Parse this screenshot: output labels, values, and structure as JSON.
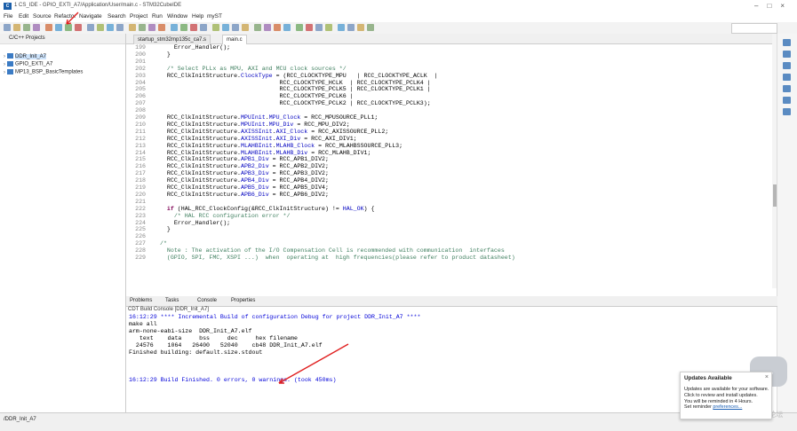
{
  "window": {
    "title": "1 CS_IDE - GPIO_EXTI_A7/Application/User/main.c - STM32CubeIDE"
  },
  "menu": [
    "File",
    "Edit",
    "Source",
    "Refactor",
    "Navigate",
    "Search",
    "Project",
    "Run",
    "Window",
    "Help",
    "myST"
  ],
  "project_explorer": {
    "title": "C/C++ Projects",
    "projects": [
      {
        "name": "DDR_Init_A7",
        "selected": true
      },
      {
        "name": "GPIO_EXTI_A7",
        "selected": false
      },
      {
        "name": "MP13_BSP_BasicTemplates",
        "selected": false
      }
    ]
  },
  "editor": {
    "tabs": [
      {
        "label": "startup_stm32mp135c_ca7.s",
        "active": false
      },
      {
        "label": "main.c",
        "active": true
      }
    ],
    "lines": [
      {
        "n": "199",
        "t": "    Error_Handler();"
      },
      {
        "n": "200",
        "t": "  }"
      },
      {
        "n": "201",
        "t": ""
      },
      {
        "n": "202",
        "t": "  /* Select PLLx as MPU, AXI and MCU clock sources */"
      },
      {
        "n": "203",
        "t": "  RCC_ClkInitStructure.ClockType = (RCC_CLOCKTYPE_MPU   | RCC_CLOCKTYPE_ACLK  |"
      },
      {
        "n": "204",
        "t": "                                  RCC_CLOCKTYPE_HCLK  | RCC_CLOCKTYPE_PCLK4 |"
      },
      {
        "n": "205",
        "t": "                                  RCC_CLOCKTYPE_PCLK5 | RCC_CLOCKTYPE_PCLK1 |"
      },
      {
        "n": "206",
        "t": "                                  RCC_CLOCKTYPE_PCLK6 |"
      },
      {
        "n": "207",
        "t": "                                  RCC_CLOCKTYPE_PCLK2 | RCC_CLOCKTYPE_PCLK3);"
      },
      {
        "n": "208",
        "t": ""
      },
      {
        "n": "209",
        "t": "  RCC_ClkInitStructure.MPUInit.MPU_Clock = RCC_MPUSOURCE_PLL1;"
      },
      {
        "n": "210",
        "t": "  RCC_ClkInitStructure.MPUInit.MPU_Div = RCC_MPU_DIV2;"
      },
      {
        "n": "211",
        "t": "  RCC_ClkInitStructure.AXISSInit.AXI_Clock = RCC_AXISSOURCE_PLL2;"
      },
      {
        "n": "212",
        "t": "  RCC_ClkInitStructure.AXISSInit.AXI_Div = RCC_AXI_DIV1;"
      },
      {
        "n": "213",
        "t": "  RCC_ClkInitStructure.MLAHBInit.MLAHB_Clock = RCC_MLAHBSSOURCE_PLL3;"
      },
      {
        "n": "214",
        "t": "  RCC_ClkInitStructure.MLAHBInit.MLAHB_Div = RCC_MLAHB_DIV1;"
      },
      {
        "n": "215",
        "t": "  RCC_ClkInitStructure.APB1_Div = RCC_APB1_DIV2;"
      },
      {
        "n": "216",
        "t": "  RCC_ClkInitStructure.APB2_Div = RCC_APB2_DIV2;"
      },
      {
        "n": "217",
        "t": "  RCC_ClkInitStructure.APB3_Div = RCC_APB3_DIV2;"
      },
      {
        "n": "218",
        "t": "  RCC_ClkInitStructure.APB4_Div = RCC_APB4_DIV2;"
      },
      {
        "n": "219",
        "t": "  RCC_ClkInitStructure.APB5_Div = RCC_APB5_DIV4;"
      },
      {
        "n": "220",
        "t": "  RCC_ClkInitStructure.APB6_Div = RCC_APB6_DIV2;"
      },
      {
        "n": "221",
        "t": ""
      },
      {
        "n": "222",
        "t": "  if (HAL_RCC_ClockConfig(&RCC_ClkInitStructure) != HAL_OK) {"
      },
      {
        "n": "223",
        "t": "    /* HAL RCC configuration error */"
      },
      {
        "n": "224",
        "t": "    Error_Handler();"
      },
      {
        "n": "225",
        "t": "  }"
      },
      {
        "n": "226",
        "t": ""
      },
      {
        "n": "227",
        "t": "/*"
      },
      {
        "n": "228",
        "t": "  Note : The activation of the I/O Compensation Cell is recommended with communication  interfaces"
      },
      {
        "n": "229",
        "t": "  (GPIO, SPI, FMC, XSPI ...)  when  operating at  high frequencies(please refer to product datasheet)"
      }
    ]
  },
  "console": {
    "tabs": [
      "Problems",
      "Tasks",
      "Console",
      "Properties"
    ],
    "title": "CDT Build Console [DDR_Init_A7]",
    "lines": [
      {
        "t": "16:12:29 **** Incremental Build of configuration Debug for project DDR_Init_A7 ****",
        "blue": true
      },
      {
        "t": "make all",
        "blue": false
      },
      {
        "t": "arm-none-eabi-size  DDR_Init_A7.elf",
        "blue": false
      },
      {
        "t": "   text    data     bss     dec     hex filename",
        "blue": false
      },
      {
        "t": "  24576    1064   26400   52040    cb48 DDR_Init_A7.elf",
        "blue": false
      },
      {
        "t": "Finished building: default.size.stdout",
        "blue": false
      },
      {
        "t": "",
        "blue": false
      },
      {
        "t": "",
        "blue": false
      },
      {
        "t": "",
        "blue": false
      },
      {
        "t": "16:12:29 Build Finished. 0 errors, 0 warnings. (took 450ms)",
        "blue": true
      }
    ]
  },
  "status_bar": {
    "text": "/DDR_Init_A7"
  },
  "notification": {
    "title": "Updates Available",
    "close": "×",
    "body": "Updates are available for your software.\nClick to review and install updates.\nYou will be reminded in 4 Hours.\nSet reminder ",
    "link": "preferences..."
  },
  "watermark": {
    "text": "ST中文论坛"
  }
}
